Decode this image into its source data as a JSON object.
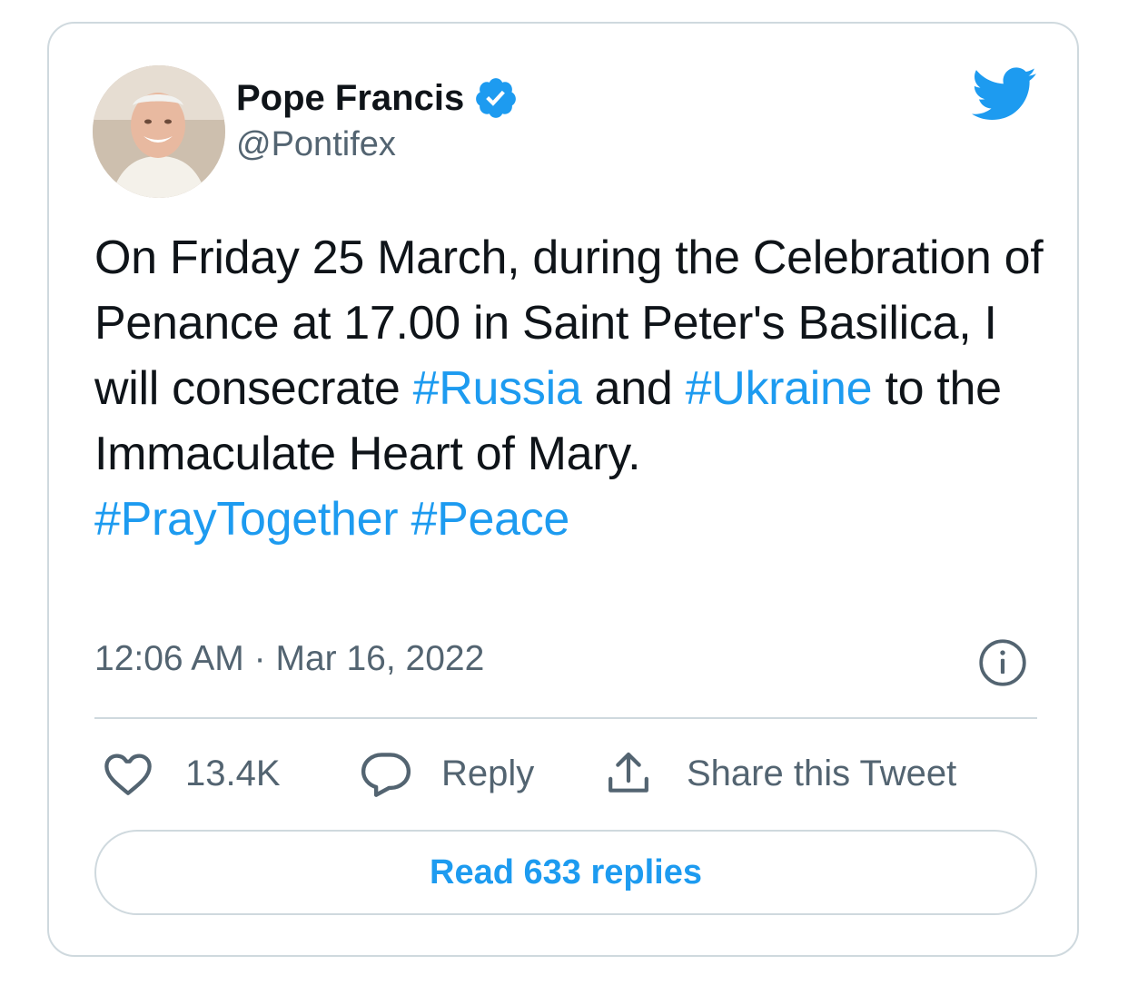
{
  "tweet": {
    "author": {
      "display_name": "Pope Francis",
      "handle": "@Pontifex",
      "verified": true,
      "avatar_icon": "avatar-photo"
    },
    "text_parts": [
      {
        "text": "On Friday 25 March, during the Celebration of Penance at 17.00 in Saint Peter's Basilica, I will consecrate ",
        "hashtag": false
      },
      {
        "text": "#Russia",
        "hashtag": true
      },
      {
        "text": " and ",
        "hashtag": false
      },
      {
        "text": "#Ukraine",
        "hashtag": true
      },
      {
        "text": " to the Immaculate Heart of Mary. ",
        "hashtag": false
      },
      {
        "text": "#PrayTogether",
        "hashtag": true
      },
      {
        "text": " ",
        "hashtag": false
      },
      {
        "text": "#Peace",
        "hashtag": true
      }
    ],
    "time": "12:06 AM",
    "separator": "·",
    "date": "Mar 16, 2022"
  },
  "actions": {
    "like_count": "13.4K",
    "reply_label": "Reply",
    "share_label": "Share this Tweet",
    "read_replies_label": "Read 633 replies"
  },
  "icons": {
    "brand": "twitter-bird-icon",
    "verified": "verified-badge-icon",
    "info": "info-icon",
    "like": "heart-icon",
    "reply": "speech-bubble-icon",
    "share": "share-upload-icon"
  },
  "colors": {
    "accent": "#1d9bf0",
    "text": "#0f1419",
    "secondary": "#536471",
    "border": "#cfd9de"
  }
}
